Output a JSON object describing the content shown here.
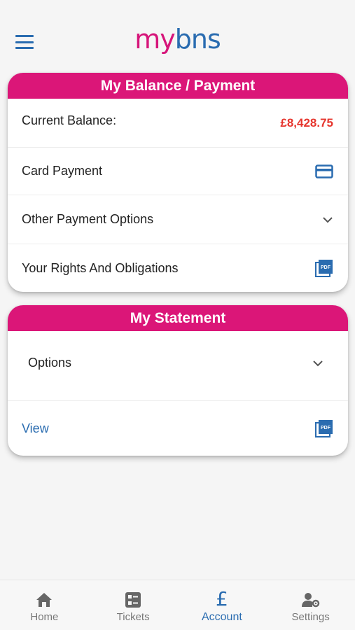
{
  "app": {
    "logo_my": "my",
    "logo_bns": "bns"
  },
  "balance_card": {
    "title": "My Balance / Payment",
    "current_balance_label": "Current Balance:",
    "current_balance_value": "£8,428.75",
    "card_payment_label": "Card Payment",
    "other_options_label": "Other Payment Options",
    "rights_label": "Your Rights And Obligations"
  },
  "statement_card": {
    "title": "My Statement",
    "options_label": "Options",
    "view_label": "View"
  },
  "tabs": [
    {
      "label": "Home",
      "icon": "home-icon"
    },
    {
      "label": "Tickets",
      "icon": "tickets-icon"
    },
    {
      "label": "Account",
      "icon": "pound-icon",
      "symbol": "£"
    },
    {
      "label": "Settings",
      "icon": "user-settings-icon"
    }
  ],
  "colors": {
    "brand_pink": "#db1678",
    "brand_blue": "#2a6cb0",
    "amount_red": "#e6362e"
  }
}
